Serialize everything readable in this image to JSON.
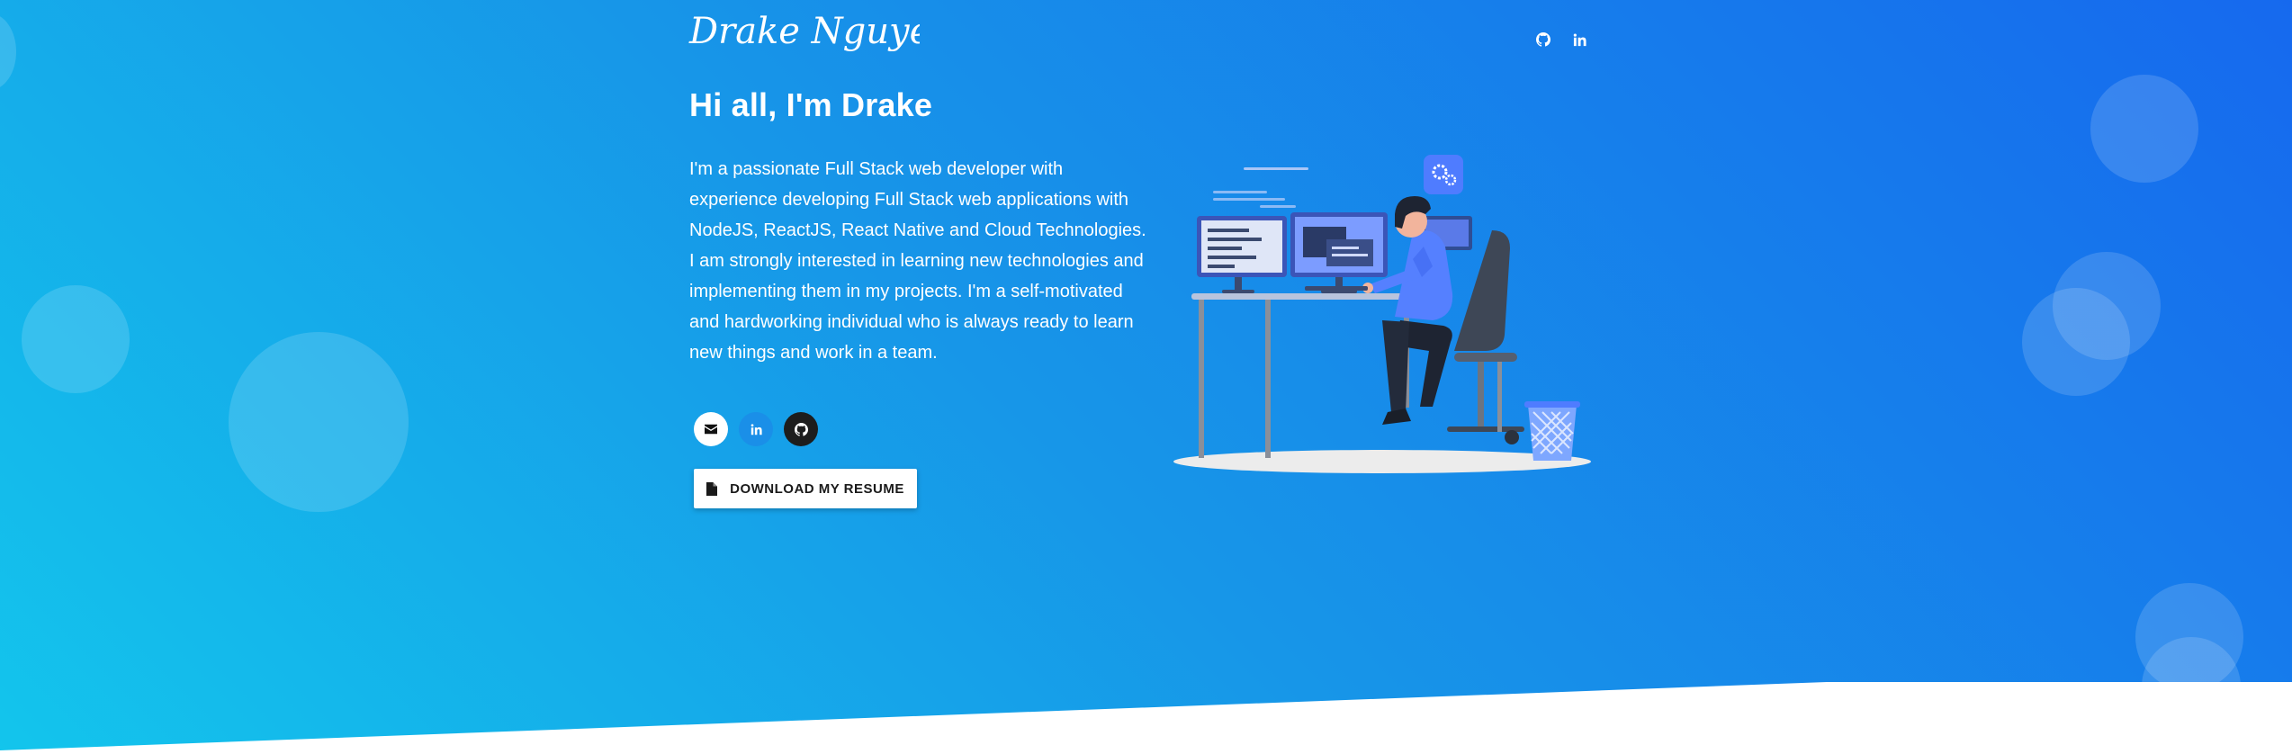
{
  "brand": {
    "logo_text": "Drake Nguyen"
  },
  "header": {
    "icons": [
      {
        "name": "github-icon"
      },
      {
        "name": "linkedin-icon"
      }
    ]
  },
  "hero": {
    "greeting": "Hi all, I'm Drake",
    "bio": "I'm a passionate Full Stack web developer with experience developing Full Stack web applications with NodeJS, ReactJS, React Native and Cloud Technologies. I am strongly interested in learning new technologies and implementing them in my projects. I'm a self-motivated and hardworking individual who is always ready to learn new things and work in a team.",
    "social": [
      {
        "name": "email-icon",
        "bg": "#ffffff"
      },
      {
        "name": "linkedin-icon",
        "bg": "#1a8fe8"
      },
      {
        "name": "github-icon",
        "bg": "#1d1d1d"
      }
    ],
    "resume_button": "DOWNLOAD MY RESUME"
  },
  "colors": {
    "gradient_start": "#13c5ec",
    "gradient_end": "#1669ee",
    "accent": "#4f7cff"
  }
}
